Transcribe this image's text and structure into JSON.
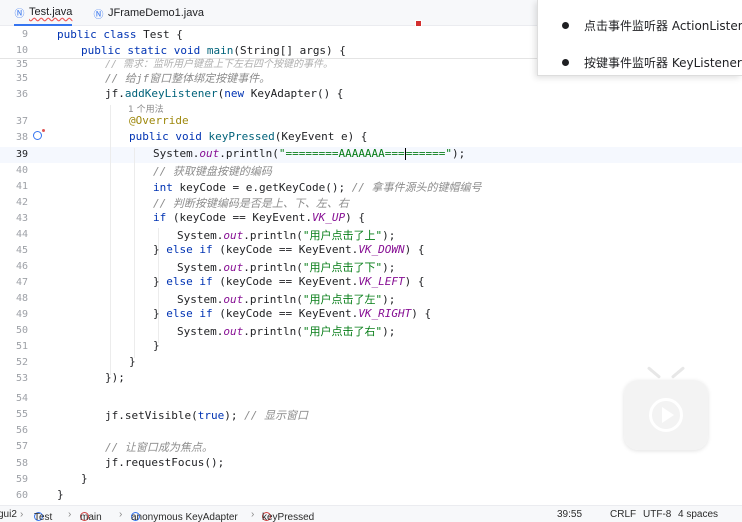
{
  "tabs": [
    {
      "label": "Test.java",
      "active": true
    },
    {
      "label": "JFrameDemo1.java",
      "active": false
    }
  ],
  "sticky": [
    {
      "num": "9",
      "code": "public class Test {"
    },
    {
      "num": "10",
      "code": "public static void main(String[] args) {"
    }
  ],
  "lines": [
    {
      "num": "35",
      "text": "// 需求：监听用户键盘上下左右四个按键的事件。"
    },
    {
      "num": "35",
      "text": "// 给jf窗口整体绑定按键事件。"
    },
    {
      "num": "36",
      "text": "jf.addKeyListener(new KeyAdapter() {"
    },
    {
      "num": "37",
      "text": "@Override"
    },
    {
      "num": "38",
      "text": "public void keyPressed(KeyEvent e) {"
    },
    {
      "num": "39",
      "text": "System.out.println(\"========AAAAAAA===|======\");"
    },
    {
      "num": "40",
      "text": "// 获取键盘按键的编码"
    },
    {
      "num": "41",
      "text": "int keyCode = e.getKeyCode(); // 拿事件源头的键帽编号"
    },
    {
      "num": "42",
      "text": "// 判断按键编码是否是上、下、左、右"
    },
    {
      "num": "43",
      "text": "if (keyCode == KeyEvent.VK_UP) {"
    },
    {
      "num": "44",
      "text": "System.out.println(\"用户点击了上\");"
    },
    {
      "num": "45",
      "text": "} else if (keyCode == KeyEvent.VK_DOWN) {"
    },
    {
      "num": "46",
      "text": "System.out.println(\"用户点击了下\");"
    },
    {
      "num": "47",
      "text": "} else if (keyCode == KeyEvent.VK_LEFT) {"
    },
    {
      "num": "48",
      "text": "System.out.println(\"用户点击了左\");"
    },
    {
      "num": "49",
      "text": "} else if (keyCode == KeyEvent.VK_RIGHT) {"
    },
    {
      "num": "50",
      "text": "System.out.println(\"用户点击了右\");"
    },
    {
      "num": "51",
      "text": "}"
    },
    {
      "num": "52",
      "text": "}"
    },
    {
      "num": "53",
      "text": "});"
    },
    {
      "num": "54",
      "text": ""
    },
    {
      "num": "55",
      "text": "jf.setVisible(true); // 显示窗口"
    },
    {
      "num": "56",
      "text": ""
    },
    {
      "num": "57",
      "text": "// 让窗口成为焦点。"
    },
    {
      "num": "58",
      "text": "jf.requestFocus();"
    },
    {
      "num": "59",
      "text": "}"
    },
    {
      "num": "60",
      "text": "}"
    }
  ],
  "inlay_hint": "1 个用法",
  "popup": {
    "items": [
      "点击事件监听器 ActionListener",
      "按键事件监听器 KeyListener"
    ]
  },
  "status": {
    "crumbs": [
      "gui2",
      "Test",
      "main",
      "anonymous KeyAdapter",
      "keyPressed"
    ],
    "position": "39:55",
    "line_ending": "CRLF",
    "encoding": "UTF-8",
    "indent": "4 spaces"
  },
  "colors": {
    "keyword": "#0033b3",
    "string": "#067d17",
    "comment": "#8c8c8c",
    "annotation": "#9e880d",
    "field": "#871094",
    "accent": "#3574f0"
  }
}
